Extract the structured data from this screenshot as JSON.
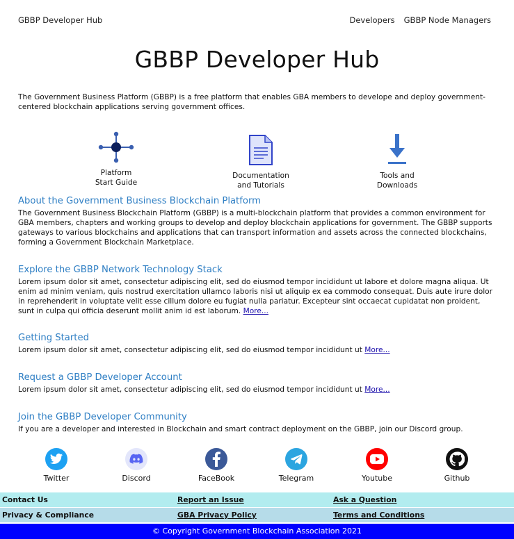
{
  "nav": {
    "brand": "GBBP Developer Hub",
    "links": [
      "Developers",
      "GBBP Node Managers"
    ]
  },
  "hero": {
    "title": "GBBP Developer Hub"
  },
  "intro": "The Government Business Platform (GBBP) is a free platform that enables GBA members to develope and deploy government-centered blockchain applications serving government offices.",
  "features": [
    {
      "label": "Platform\nStart Guide",
      "icon": "network-hub-icon"
    },
    {
      "label": "Documentation\nand Tutorials",
      "icon": "document-icon"
    },
    {
      "label": "Tools and\nDownloads",
      "icon": "download-arrow-icon"
    }
  ],
  "sections": [
    {
      "title": "About the Government Business Blockchain Platform",
      "body": "The Government Business Blockchain Platform (GBBP) is a multi-blockchain platform that provides a common environment for GBA members, chapters and working groups to develop and deploy blockchain applications for government. The GBBP supports gateways to various blockchains and applications that can transport information and assets across the connected blockchains, forming a Government Blockchain Marketplace.",
      "more": ""
    },
    {
      "title": "Explore the GBBP Network Technology Stack",
      "body": "Lorem ipsum dolor sit amet, consectetur adipiscing elit, sed do eiusmod tempor incididunt ut labore et dolore magna aliqua. Ut enim ad minim veniam, quis nostrud exercitation ullamco laboris nisi ut aliquip ex ea commodo consequat. Duis aute irure dolor in reprehenderit in voluptate velit esse cillum dolore eu fugiat nulla pariatur. Excepteur sint occaecat cupidatat non proident, sunt in culpa qui officia deserunt mollit anim id est laborum. ",
      "more": "More..."
    },
    {
      "title": "Getting Started",
      "body": "Lorem ipsum dolor sit amet, consectetur adipiscing elit, sed do eiusmod tempor incididunt ut ",
      "more": "More..."
    },
    {
      "title": "Request a GBBP Developer Account",
      "body": "Lorem ipsum dolor sit amet, consectetur adipiscing elit, sed do eiusmod tempor incididunt ut ",
      "more": "More..."
    },
    {
      "title": "Join the GBBP Developer Community",
      "body": "If you are a developer and interested in Blockchain and smart contract deployment on the GBBP, join our Discord group.",
      "more": ""
    }
  ],
  "social": [
    {
      "name": "Twitter",
      "icon": "twitter-icon",
      "color": "#1da1f2"
    },
    {
      "name": "Discord",
      "icon": "discord-icon",
      "color": "#5865f2"
    },
    {
      "name": "FaceBook",
      "icon": "facebook-icon",
      "color": "#3b5998"
    },
    {
      "name": "Telegram",
      "icon": "telegram-icon",
      "color": "#2ca5e0"
    },
    {
      "name": "Youtube",
      "icon": "youtube-icon",
      "color": "#ff0000"
    },
    {
      "name": "Github",
      "icon": "github-icon",
      "color": "#111111"
    }
  ],
  "footer": {
    "row1": [
      "Contact Us",
      "Report an Issue",
      "Ask a Question"
    ],
    "row2": [
      "Privacy & Compliance",
      "GBA Privacy Policy",
      "Terms and Conditions"
    ],
    "copyright": "© Copyright Government Blockchain Association 2021"
  },
  "colors": {
    "accent_link": "#2f7fc4",
    "footer_row1": "#b2ecef",
    "footer_row2": "#b6dce9",
    "copyright_bar": "#0000ff"
  }
}
